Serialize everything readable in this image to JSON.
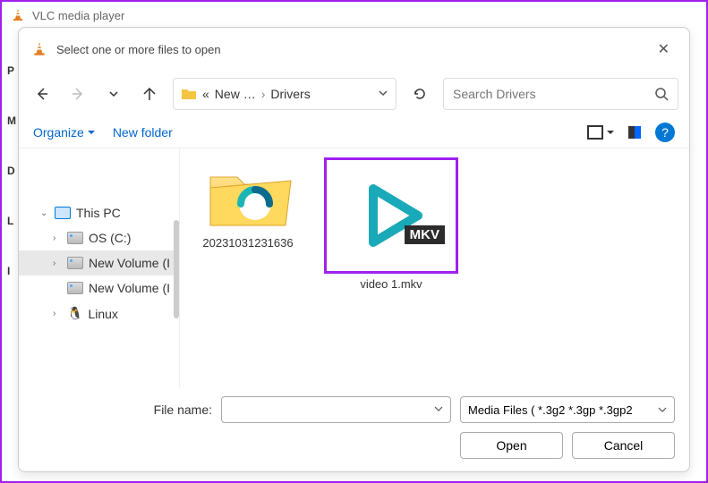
{
  "app": {
    "title": "VLC media player"
  },
  "dialog": {
    "title": "Select one or more files to open"
  },
  "nav": {
    "prefix": "«",
    "crumb1": "New …",
    "crumb2": "Drivers"
  },
  "search": {
    "placeholder": "Search Drivers"
  },
  "toolbar": {
    "organize": "Organize",
    "new_folder": "New folder",
    "help_glyph": "?"
  },
  "sidebar": {
    "this_pc": "This PC",
    "os": "OS (C:)",
    "vol1": "New Volume (I",
    "vol2": "New Volume (I",
    "linux": "Linux"
  },
  "files": {
    "folder": {
      "name": "20231031231636"
    },
    "video": {
      "name": "video 1.mkv",
      "badge": "MKV"
    }
  },
  "footer": {
    "filename_label": "File name:",
    "filter": "Media Files ( *.3g2 *.3gp *.3gp2",
    "open": "Open",
    "cancel": "Cancel"
  },
  "left_edge": [
    "P",
    "M",
    "D",
    "L",
    "I"
  ]
}
